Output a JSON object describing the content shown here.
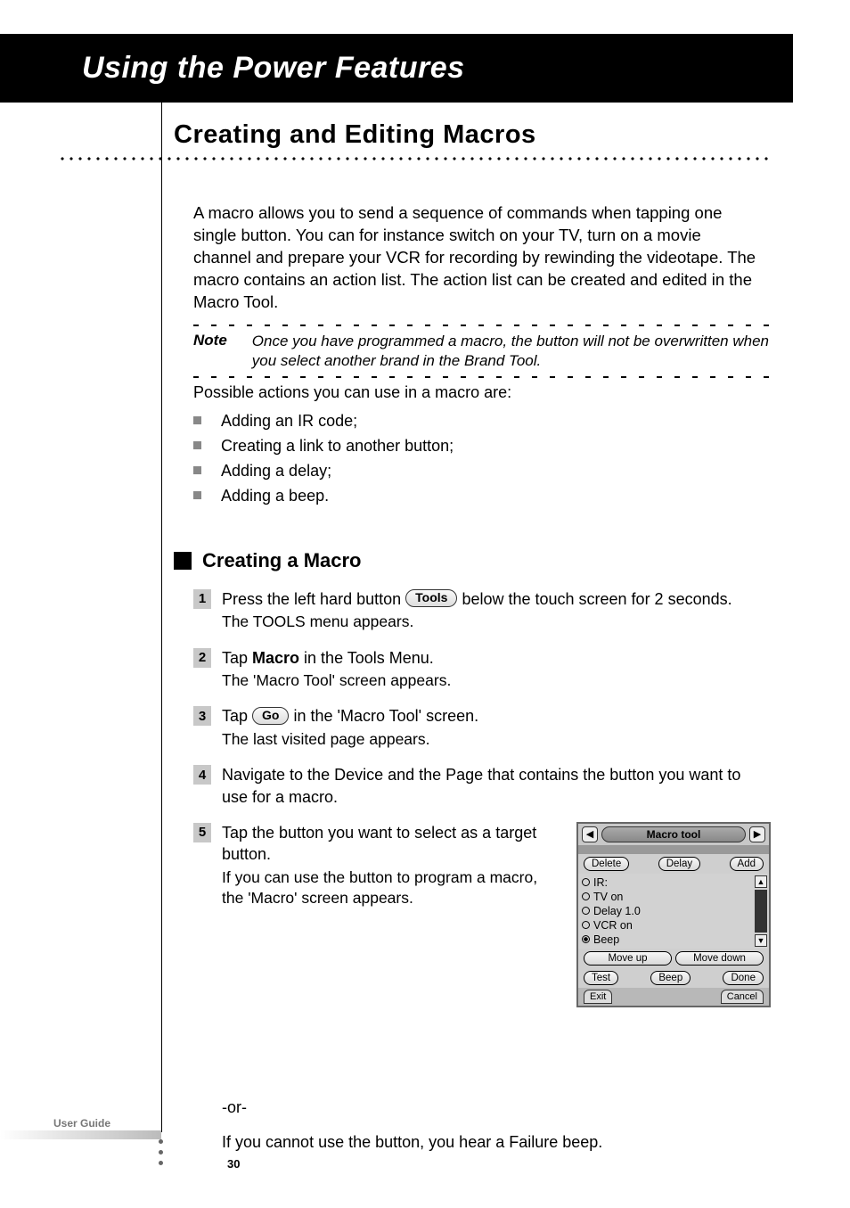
{
  "banner": {
    "title": "Using the Power Features"
  },
  "section": {
    "title": "Creating and Editing Macros"
  },
  "intro": "A macro allows you to send a sequence of commands when tapping one single button. You can for instance switch on your TV, turn on a movie channel and prepare your VCR for recording by rewinding the videotape. The macro contains an action list. The action list can be created and edited in the Macro Tool.",
  "note": {
    "label": "Note",
    "text": "Once you have programmed a macro, the button will not be overwritten when you select another brand in the Brand Tool."
  },
  "possible_intro": "Possible actions you can use in a macro are:",
  "bullets": [
    "Adding an IR code;",
    "Creating a link to another button;",
    "Adding a delay;",
    "Adding a beep."
  ],
  "subheading": "Creating a Macro",
  "inline_buttons": {
    "tools": "Tools",
    "go": "Go"
  },
  "steps": {
    "s1": {
      "pre": "Press the left hard button ",
      "post": " below the touch screen for 2 seconds.",
      "sub": "The TOOLS menu appears."
    },
    "s2": {
      "pre": "Tap ",
      "bold": "Macro",
      "post": " in the Tools Menu.",
      "sub": "The 'Macro Tool' screen appears."
    },
    "s3": {
      "pre": "Tap ",
      "post": " in the 'Macro Tool' screen.",
      "sub": "The last visited page appears."
    },
    "s4": {
      "main": "Navigate to the Device and the Page that contains the button you want to use for a macro."
    },
    "s5": {
      "main": "Tap the button you want to select as a target button.",
      "sub": "If you can use the button to program a macro, the 'Macro' screen appears."
    }
  },
  "or_text": "-or-",
  "failure_text": "If you cannot use the button, you hear a Failure beep.",
  "device": {
    "title": "Macro tool",
    "top_buttons": {
      "delete": "Delete",
      "delay": "Delay",
      "add": "Add"
    },
    "actions": [
      "IR:",
      "TV on",
      "Delay 1.0",
      "VCR on",
      "Beep"
    ],
    "selected_index": 4,
    "mid_buttons": {
      "moveup": "Move up",
      "movedown": "Move down"
    },
    "bottom_buttons": {
      "test": "Test",
      "beep": "Beep",
      "done": "Done"
    },
    "tabs": {
      "exit": "Exit",
      "cancel": "Cancel"
    }
  },
  "footer": {
    "guide": "User Guide",
    "page": "30"
  }
}
